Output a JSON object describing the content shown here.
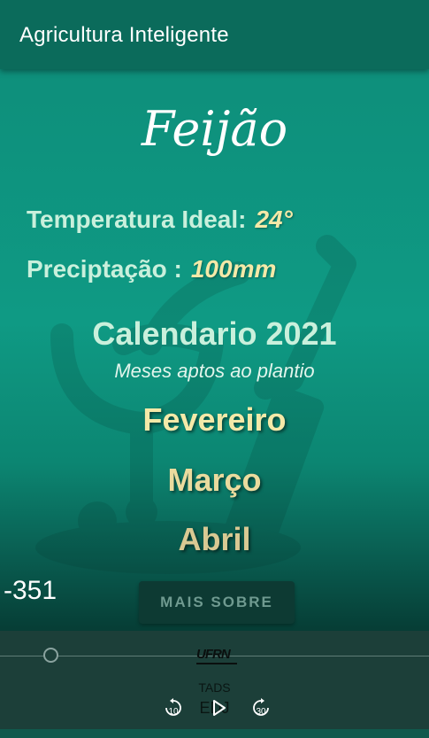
{
  "appbar": {
    "title": "Agricultura Inteligente"
  },
  "crop": {
    "name": "Feijão",
    "temperature_label": "Temperatura Ideal:",
    "temperature_value": "24°",
    "precipitation_label": "Preciptação :",
    "precipitation_value": "100mm"
  },
  "calendar": {
    "title": "Calendario 2021",
    "subtitle": "Meses aptos ao plantio",
    "months": [
      "Fevereiro",
      "Março",
      "Abril"
    ]
  },
  "counter_text": "-351",
  "more_button_label": "MAIS SOBRE",
  "player": {
    "logo_text": "UFRN",
    "tads_text": "TADS",
    "edj_text": "EDJ",
    "rewind_seconds": "10",
    "forward_seconds": "30",
    "progress_fraction": 0.12
  },
  "colors": {
    "appbar": "#0b6b5b",
    "content_top": "#0e8f7b",
    "value_accent": "#f4e9a8",
    "label_text": "#c9f0dc"
  },
  "icons": {
    "watermark": "plant-shovel-icon",
    "rewind": "rewind-10-icon",
    "play": "play-icon",
    "forward": "forward-30-icon"
  }
}
